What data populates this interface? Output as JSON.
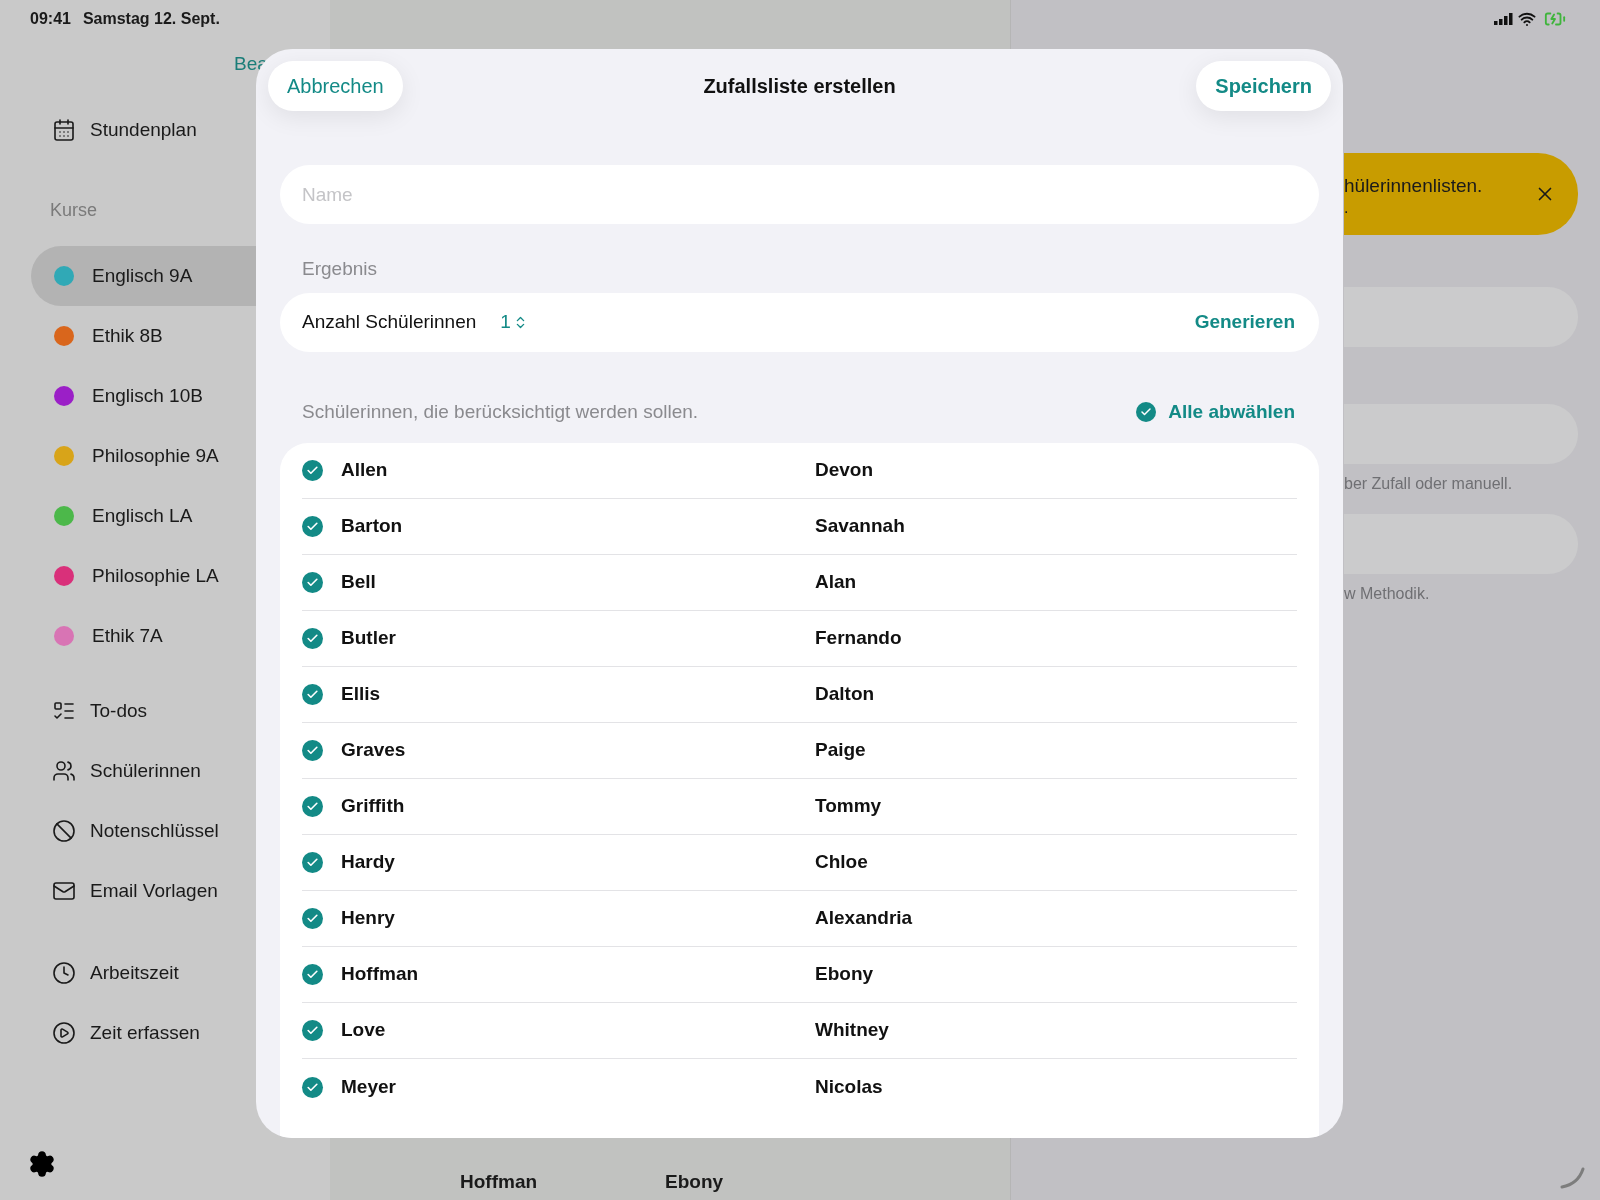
{
  "status_bar": {
    "time": "09:41",
    "date": "Samstag 12. Sept."
  },
  "sidebar": {
    "edit_link": "Bea",
    "top_items": [
      {
        "label": "Stundenplan"
      }
    ],
    "section": "Kurse",
    "courses": [
      {
        "label": "Englisch 9A",
        "color": "#30a9b6",
        "selected": true
      },
      {
        "label": "Ethik 8B",
        "color": "#d9661c",
        "selected": false
      },
      {
        "label": "Englisch 10B",
        "color": "#9b1fc7",
        "selected": false
      },
      {
        "label": "Philosophie 9A",
        "color": "#d8a419",
        "selected": false
      },
      {
        "label": "Englisch LA",
        "color": "#4cb84a",
        "selected": false
      },
      {
        "label": "Philosophie LA",
        "color": "#d9307a",
        "selected": false
      },
      {
        "label": "Ethik 7A",
        "color": "#d874b4",
        "selected": false
      }
    ],
    "tool_items": [
      {
        "label": "To-dos"
      },
      {
        "label": "Schülerinnen"
      },
      {
        "label": "Notenschlüssel"
      },
      {
        "label": "Email Vorlagen"
      }
    ],
    "time_items": [
      {
        "label": "Arbeitszeit"
      },
      {
        "label": "Zeit erfassen"
      }
    ]
  },
  "background": {
    "banner": {
      "line_1": "hülerinnenlisten.",
      "line_2": "."
    },
    "notes": [
      "ber Zufall oder manuell.",
      "w Methodik."
    ],
    "bottom_row": [
      "Hoffman",
      "Ebony"
    ]
  },
  "modal": {
    "title": "Zufallsliste erstellen",
    "cancel": "Abbrechen",
    "save": "Speichern",
    "name_placeholder": "Name",
    "result_label": "Ergebnis",
    "count_label": "Anzahl Schülerinnen",
    "count_value": "1",
    "generate": "Generieren",
    "students_label": "Schülerinnen, die berücksichtigt werden sollen.",
    "deselect_all": "Alle abwählen",
    "students": [
      {
        "last": "Allen",
        "first": "Devon",
        "checked": true
      },
      {
        "last": "Barton",
        "first": "Savannah",
        "checked": true
      },
      {
        "last": "Bell",
        "first": "Alan",
        "checked": true
      },
      {
        "last": "Butler",
        "first": "Fernando",
        "checked": true
      },
      {
        "last": "Ellis",
        "first": "Dalton",
        "checked": true
      },
      {
        "last": "Graves",
        "first": "Paige",
        "checked": true
      },
      {
        "last": "Griffith",
        "first": "Tommy",
        "checked": true
      },
      {
        "last": "Hardy",
        "first": "Chloe",
        "checked": true
      },
      {
        "last": "Henry",
        "first": "Alexandria",
        "checked": true
      },
      {
        "last": "Hoffman",
        "first": "Ebony",
        "checked": true
      },
      {
        "last": "Love",
        "first": "Whitney",
        "checked": true
      },
      {
        "last": "Meyer",
        "first": "Nicolas",
        "checked": true
      }
    ]
  }
}
